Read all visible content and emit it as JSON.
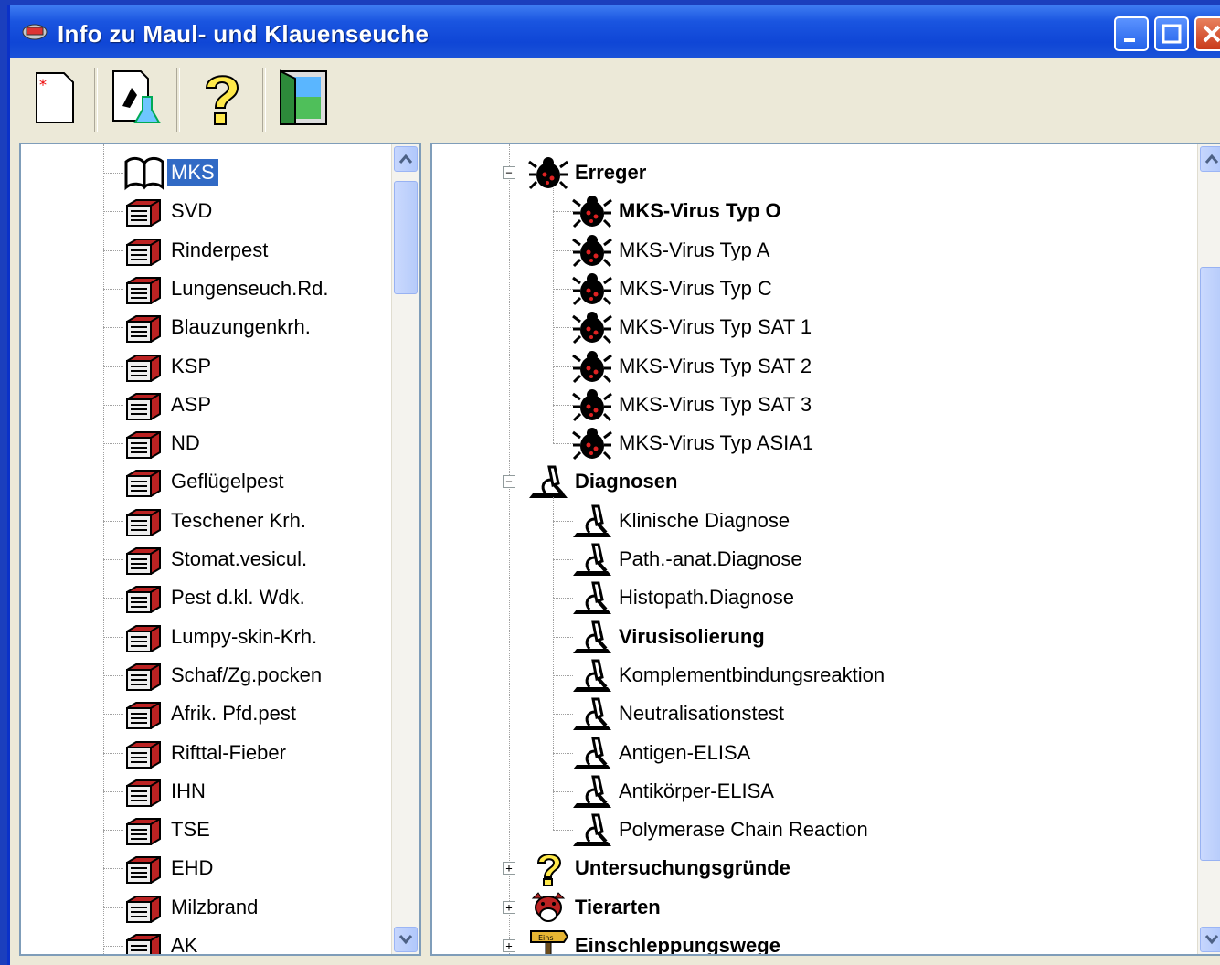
{
  "window": {
    "title": "Info zu Maul- und Klauenseuche",
    "controls": [
      "minimize",
      "maximize",
      "close"
    ]
  },
  "toolbar": {
    "buttons": [
      {
        "icon": "new-document-icon"
      },
      {
        "icon": "lab-report-icon"
      },
      {
        "icon": "help-question-icon"
      },
      {
        "icon": "exit-door-icon"
      }
    ]
  },
  "left_tree": {
    "items": [
      {
        "label": "MKS",
        "icon": "open-book-icon",
        "selected": true
      },
      {
        "label": "SVD",
        "icon": "book-stack-icon"
      },
      {
        "label": "Rinderpest",
        "icon": "book-stack-icon"
      },
      {
        "label": "Lungenseuch.Rd.",
        "icon": "book-stack-icon"
      },
      {
        "label": "Blauzungenkrh.",
        "icon": "book-stack-icon"
      },
      {
        "label": "KSP",
        "icon": "book-stack-icon"
      },
      {
        "label": "ASP",
        "icon": "book-stack-icon"
      },
      {
        "label": "ND",
        "icon": "book-stack-icon"
      },
      {
        "label": "Geflügelpest",
        "icon": "book-stack-icon"
      },
      {
        "label": "Teschener Krh.",
        "icon": "book-stack-icon"
      },
      {
        "label": "Stomat.vesicul.",
        "icon": "book-stack-icon"
      },
      {
        "label": "Pest d.kl. Wdk.",
        "icon": "book-stack-icon"
      },
      {
        "label": "Lumpy-skin-Krh.",
        "icon": "book-stack-icon"
      },
      {
        "label": "Schaf/Zg.pocken",
        "icon": "book-stack-icon"
      },
      {
        "label": "Afrik. Pfd.pest",
        "icon": "book-stack-icon"
      },
      {
        "label": "Rifttal-Fieber",
        "icon": "book-stack-icon"
      },
      {
        "label": "IHN",
        "icon": "book-stack-icon"
      },
      {
        "label": "TSE",
        "icon": "book-stack-icon"
      },
      {
        "label": "EHD",
        "icon": "book-stack-icon"
      },
      {
        "label": "Milzbrand",
        "icon": "book-stack-icon"
      },
      {
        "label": "AK",
        "icon": "book-stack-icon"
      }
    ]
  },
  "right_tree": {
    "erreger": {
      "label": "Erreger",
      "icon": "virus-bug-icon",
      "expanded": true,
      "children": [
        {
          "label": "MKS-Virus Typ O",
          "bold": true
        },
        {
          "label": "MKS-Virus Typ A"
        },
        {
          "label": "MKS-Virus Typ C"
        },
        {
          "label": "MKS-Virus Typ SAT 1"
        },
        {
          "label": "MKS-Virus Typ SAT 2"
        },
        {
          "label": "MKS-Virus Typ SAT 3"
        },
        {
          "label": "MKS-Virus Typ ASIA1"
        }
      ]
    },
    "diagnosen": {
      "label": "Diagnosen",
      "icon": "microscope-icon",
      "expanded": true,
      "children": [
        {
          "label": "Klinische Diagnose"
        },
        {
          "label": "Path.-anat.Diagnose"
        },
        {
          "label": "Histopath.Diagnose"
        },
        {
          "label": "Virusisolierung",
          "bold": true
        },
        {
          "label": "Komplementbindungsreaktion"
        },
        {
          "label": "Neutralisationstest"
        },
        {
          "label": "Antigen-ELISA"
        },
        {
          "label": "Antikörper-ELISA"
        },
        {
          "label": "Polymerase Chain Reaction"
        }
      ]
    },
    "collapsed": [
      {
        "label": "Untersuchungsgründe",
        "icon": "question-mark-icon"
      },
      {
        "label": "Tierarten",
        "icon": "cow-icon"
      },
      {
        "label": "Einschleppungswege",
        "icon": "signpost-icon"
      }
    ],
    "signpost_text": "Eins"
  },
  "colors": {
    "desktop": "#1b3fbd",
    "titlebar": "#1a55e0",
    "selection": "#316ac5",
    "window_bg": "#ece9d8"
  }
}
